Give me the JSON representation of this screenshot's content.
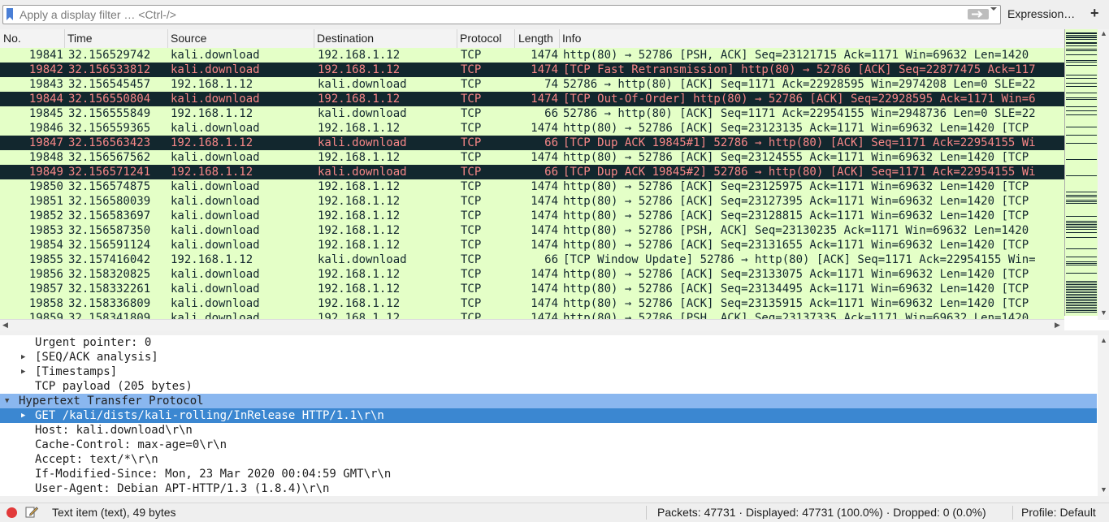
{
  "filter": {
    "placeholder": "Apply a display filter … <Ctrl-/>",
    "expression_label": "Expression…",
    "add_label": "+"
  },
  "packet_list": {
    "columns": [
      "No.",
      "Time",
      "Source",
      "Destination",
      "Protocol",
      "Length",
      "Info"
    ],
    "rows": [
      {
        "no": "19841",
        "time": "32.156529742",
        "src": "kali.download",
        "dst": "192.168.1.12",
        "proto": "TCP",
        "len": "1474",
        "info": "http(80) → 52786 [PSH, ACK] Seq=23121715 Ack=1171 Win=69632 Len=1420",
        "style": "ok"
      },
      {
        "no": "19842",
        "time": "32.156533812",
        "src": "kali.download",
        "dst": "192.168.1.12",
        "proto": "TCP",
        "len": "1474",
        "info": "[TCP Fast Retransmission] http(80) → 52786 [ACK] Seq=22877475 Ack=117",
        "style": "err"
      },
      {
        "no": "19843",
        "time": "32.156545457",
        "src": "192.168.1.12",
        "dst": "kali.download",
        "proto": "TCP",
        "len": "74",
        "info": "52786 → http(80) [ACK] Seq=1171 Ack=22928595 Win=2974208 Len=0 SLE=22",
        "style": "ok"
      },
      {
        "no": "19844",
        "time": "32.156550804",
        "src": "kali.download",
        "dst": "192.168.1.12",
        "proto": "TCP",
        "len": "1474",
        "info": "[TCP Out-Of-Order] http(80) → 52786 [ACK] Seq=22928595 Ack=1171 Win=6",
        "style": "err"
      },
      {
        "no": "19845",
        "time": "32.156555849",
        "src": "192.168.1.12",
        "dst": "kali.download",
        "proto": "TCP",
        "len": "66",
        "info": "52786 → http(80) [ACK] Seq=1171 Ack=22954155 Win=2948736 Len=0 SLE=22",
        "style": "ok"
      },
      {
        "no": "19846",
        "time": "32.156559365",
        "src": "kali.download",
        "dst": "192.168.1.12",
        "proto": "TCP",
        "len": "1474",
        "info": "http(80) → 52786 [ACK] Seq=23123135 Ack=1171 Win=69632 Len=1420 [TCP",
        "style": "ok"
      },
      {
        "no": "19847",
        "time": "32.156563423",
        "src": "192.168.1.12",
        "dst": "kali.download",
        "proto": "TCP",
        "len": "66",
        "info": "[TCP Dup ACK 19845#1] 52786 → http(80) [ACK] Seq=1171 Ack=22954155 Wi",
        "style": "err"
      },
      {
        "no": "19848",
        "time": "32.156567562",
        "src": "kali.download",
        "dst": "192.168.1.12",
        "proto": "TCP",
        "len": "1474",
        "info": "http(80) → 52786 [ACK] Seq=23124555 Ack=1171 Win=69632 Len=1420 [TCP",
        "style": "ok"
      },
      {
        "no": "19849",
        "time": "32.156571241",
        "src": "192.168.1.12",
        "dst": "kali.download",
        "proto": "TCP",
        "len": "66",
        "info": "[TCP Dup ACK 19845#2] 52786 → http(80) [ACK] Seq=1171 Ack=22954155 Wi",
        "style": "err"
      },
      {
        "no": "19850",
        "time": "32.156574875",
        "src": "kali.download",
        "dst": "192.168.1.12",
        "proto": "TCP",
        "len": "1474",
        "info": "http(80) → 52786 [ACK] Seq=23125975 Ack=1171 Win=69632 Len=1420 [TCP",
        "style": "ok"
      },
      {
        "no": "19851",
        "time": "32.156580039",
        "src": "kali.download",
        "dst": "192.168.1.12",
        "proto": "TCP",
        "len": "1474",
        "info": "http(80) → 52786 [ACK] Seq=23127395 Ack=1171 Win=69632 Len=1420 [TCP",
        "style": "ok"
      },
      {
        "no": "19852",
        "time": "32.156583697",
        "src": "kali.download",
        "dst": "192.168.1.12",
        "proto": "TCP",
        "len": "1474",
        "info": "http(80) → 52786 [ACK] Seq=23128815 Ack=1171 Win=69632 Len=1420 [TCP",
        "style": "ok"
      },
      {
        "no": "19853",
        "time": "32.156587350",
        "src": "kali.download",
        "dst": "192.168.1.12",
        "proto": "TCP",
        "len": "1474",
        "info": "http(80) → 52786 [PSH, ACK] Seq=23130235 Ack=1171 Win=69632 Len=1420",
        "style": "ok"
      },
      {
        "no": "19854",
        "time": "32.156591124",
        "src": "kali.download",
        "dst": "192.168.1.12",
        "proto": "TCP",
        "len": "1474",
        "info": "http(80) → 52786 [ACK] Seq=23131655 Ack=1171 Win=69632 Len=1420 [TCP",
        "style": "ok"
      },
      {
        "no": "19855",
        "time": "32.157416042",
        "src": "192.168.1.12",
        "dst": "kali.download",
        "proto": "TCP",
        "len": "66",
        "info": "[TCP Window Update] 52786 → http(80) [ACK] Seq=1171 Ack=22954155 Win=",
        "style": "ok"
      },
      {
        "no": "19856",
        "time": "32.158320825",
        "src": "kali.download",
        "dst": "192.168.1.12",
        "proto": "TCP",
        "len": "1474",
        "info": "http(80) → 52786 [ACK] Seq=23133075 Ack=1171 Win=69632 Len=1420 [TCP",
        "style": "ok"
      },
      {
        "no": "19857",
        "time": "32.158332261",
        "src": "kali.download",
        "dst": "192.168.1.12",
        "proto": "TCP",
        "len": "1474",
        "info": "http(80) → 52786 [ACK] Seq=23134495 Ack=1171 Win=69632 Len=1420 [TCP",
        "style": "ok"
      },
      {
        "no": "19858",
        "time": "32.158336809",
        "src": "kali.download",
        "dst": "192.168.1.12",
        "proto": "TCP",
        "len": "1474",
        "info": "http(80) → 52786 [ACK] Seq=23135915 Ack=1171 Win=69632 Len=1420 [TCP",
        "style": "ok"
      },
      {
        "no": "19859",
        "time": "32.158341809",
        "src": "kali.download",
        "dst": "192.168.1.12",
        "proto": "TCP",
        "len": "1474",
        "info": "http(80) → 52786 [PSH, ACK] Seq=23137335 Ack=1171 Win=69632 Len=1420",
        "style": "ok"
      }
    ]
  },
  "details": {
    "lines": [
      {
        "text": "Urgent pointer: 0",
        "expander": "none",
        "indent": 1,
        "state": "normal"
      },
      {
        "text": "[SEQ/ACK analysis]",
        "expander": "collapsed",
        "indent": 1,
        "state": "normal"
      },
      {
        "text": "[Timestamps]",
        "expander": "collapsed",
        "indent": 1,
        "state": "normal"
      },
      {
        "text": "TCP payload (205 bytes)",
        "expander": "none",
        "indent": 1,
        "state": "normal"
      },
      {
        "text": "Hypertext Transfer Protocol",
        "expander": "expanded",
        "indent": 0,
        "state": "parent"
      },
      {
        "text": "GET /kali/dists/kali-rolling/InRelease HTTP/1.1\\r\\n",
        "expander": "collapsed",
        "indent": 1,
        "state": "selected"
      },
      {
        "text": "Host: kali.download\\r\\n",
        "expander": "none",
        "indent": 1,
        "state": "normal"
      },
      {
        "text": "Cache-Control: max-age=0\\r\\n",
        "expander": "none",
        "indent": 1,
        "state": "normal"
      },
      {
        "text": "Accept: text/*\\r\\n",
        "expander": "none",
        "indent": 1,
        "state": "normal"
      },
      {
        "text": "If-Modified-Since: Mon, 23 Mar 2020 00:04:59 GMT\\r\\n",
        "expander": "none",
        "indent": 1,
        "state": "normal"
      },
      {
        "text": "User-Agent: Debian APT-HTTP/1.3 (1.8.4)\\r\\n",
        "expander": "none",
        "indent": 1,
        "state": "normal"
      }
    ]
  },
  "status": {
    "text": "Text item (text), 49 bytes",
    "packets": "Packets: 47731 · Displayed: 47731 (100.0%) · Dropped: 0 (0.0%)",
    "profile": "Profile: Default"
  },
  "colors": {
    "row_normal_bg": "#e4ffc7",
    "row_normal_fg": "#12272e",
    "row_error_bg": "#12272e",
    "row_error_fg": "#f78787",
    "selection": "#3b87d1",
    "selection_parent": "#8ab7ef"
  }
}
